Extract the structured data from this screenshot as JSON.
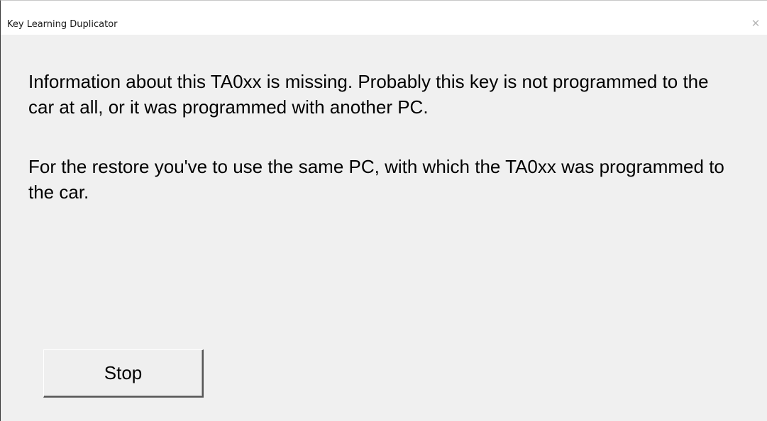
{
  "window": {
    "title": "Key Learning Duplicator",
    "close_glyph": "✕"
  },
  "dialog": {
    "message_1": "Information about this TA0xx is missing. Probably this key is not programmed to the car at all, or it was programmed with another PC.",
    "message_2": "For the restore you've to use the same PC, with which the TA0xx was programmed to the car.",
    "stop_label": "Stop"
  }
}
